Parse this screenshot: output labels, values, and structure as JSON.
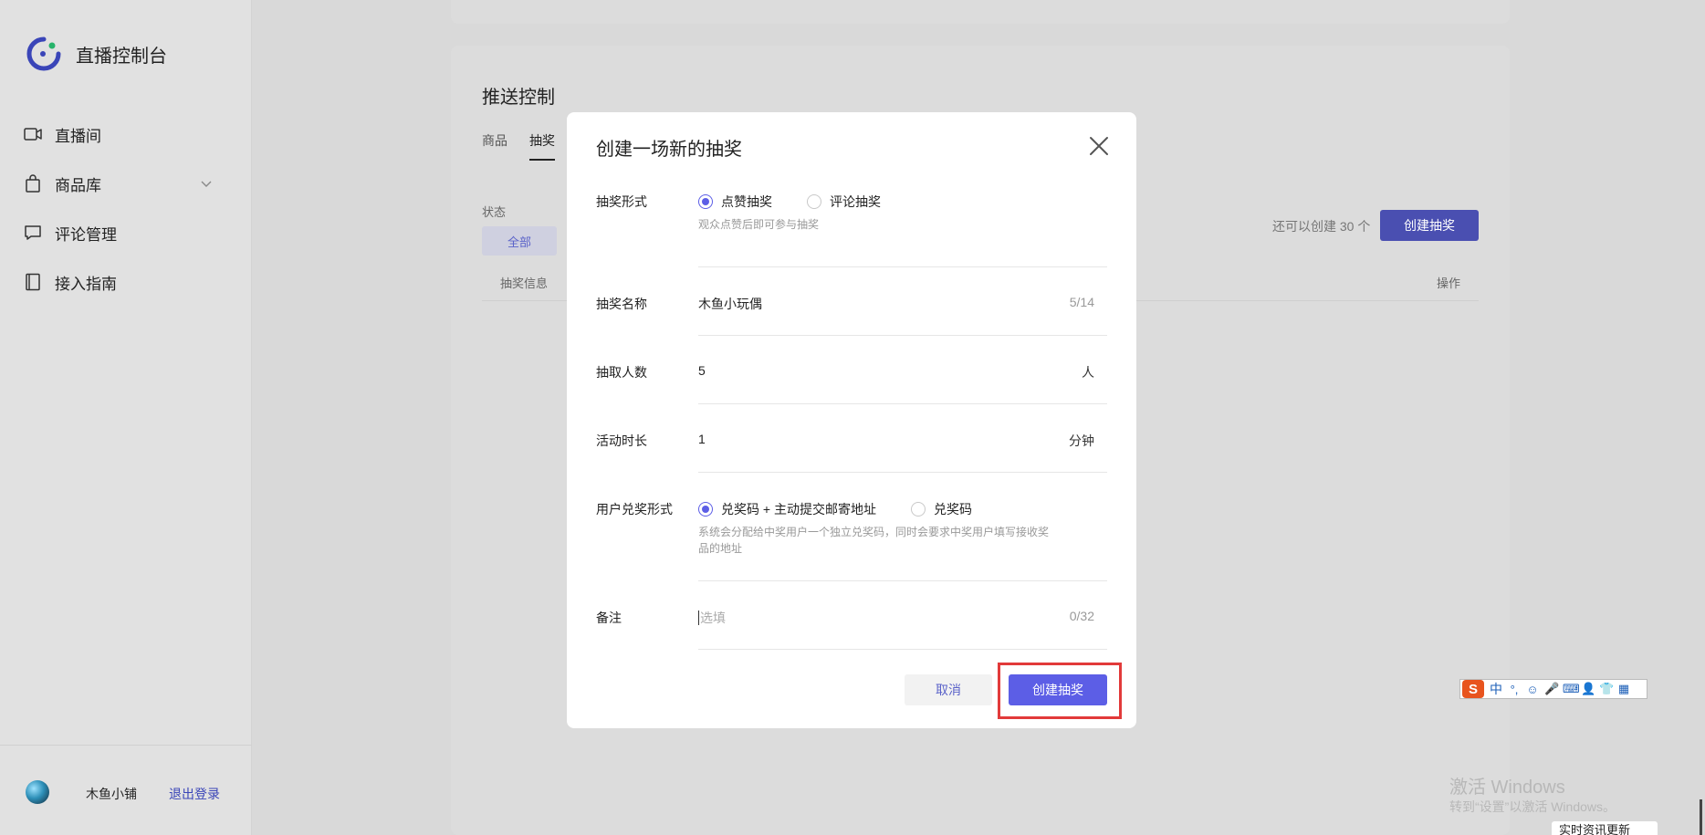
{
  "brand": {
    "title": "直播控制台",
    "accent_color": "#3a45b8",
    "dot_color": "#27b36a"
  },
  "sidebar": {
    "items": [
      {
        "label": "直播间",
        "icon": "video-camera-icon"
      },
      {
        "label": "商品库",
        "icon": "shopping-bag-icon"
      },
      {
        "label": "评论管理",
        "icon": "comment-icon"
      },
      {
        "label": "接入指南",
        "icon": "book-icon"
      }
    ],
    "user": {
      "name": "木鱼小铺",
      "logout": "退出登录"
    }
  },
  "panel": {
    "title": "推送控制",
    "tabs": [
      "商品",
      "抽奖"
    ],
    "status_label": "状态",
    "filter_all": "全部",
    "remaining": "还可以创建 30 个",
    "create_button": "创建抽奖",
    "table": {
      "col_info": "抽奖信息",
      "col_action": "操作"
    }
  },
  "modal": {
    "title": "创建一场新的抽奖",
    "fields": {
      "type": {
        "label": "抽奖形式",
        "options": [
          "点赞抽奖",
          "评论抽奖"
        ],
        "selected": "点赞抽奖",
        "hint": "观众点赞后即可参与抽奖"
      },
      "name": {
        "label": "抽奖名称",
        "value": "木鱼小玩偶",
        "counter": "5/14"
      },
      "count": {
        "label": "抽取人数",
        "value": "5",
        "unit": "人"
      },
      "duration": {
        "label": "活动时长",
        "value": "1",
        "unit": "分钟"
      },
      "redeem": {
        "label": "用户兑奖形式",
        "options": [
          "兑奖码 + 主动提交邮寄地址",
          "兑奖码"
        ],
        "selected": "兑奖码 + 主动提交邮寄地址",
        "hint_line1": "系统会分配给中奖用户一个独立兑奖码，同时会要求中奖用户填写接收奖",
        "hint_line2": "品的地址"
      },
      "note": {
        "label": "备注",
        "placeholder": "选填",
        "counter": "0/32"
      }
    },
    "cancel": "取消",
    "submit": "创建抽奖",
    "primary_color": "#5c5ee6"
  },
  "ime": {
    "logo": "S",
    "mode": "中",
    "items": [
      "°,",
      "☺",
      "🎤",
      "⌨",
      "👤",
      "👕",
      "▦"
    ]
  },
  "watermark": {
    "title": "激活 Windows",
    "subtitle": "转到“设置”以激活 Windows。"
  },
  "news_tab": "实时资讯更新"
}
